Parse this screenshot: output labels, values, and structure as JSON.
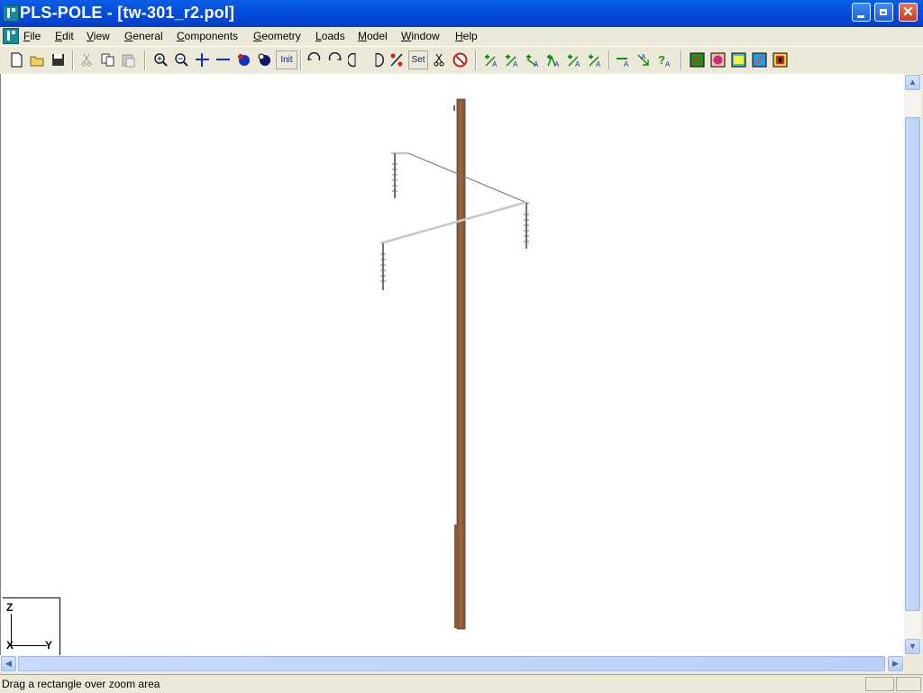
{
  "titlebar": {
    "title": "PLS-POLE - [tw-301_r2.pol]",
    "minimize_icon": "minimize-icon",
    "restore_icon": "restore-icon",
    "close_icon": "close-icon"
  },
  "menubar": {
    "items": [
      "File",
      "Edit",
      "View",
      "General",
      "Components",
      "Geometry",
      "Loads",
      "Model",
      "Window",
      "Help"
    ]
  },
  "toolbar": {
    "init_label": "Init",
    "set_label": "Set",
    "buttons": [
      "new-document-icon",
      "open-folder-icon",
      "save-disk-icon",
      "cut-icon",
      "copy-icon",
      "paste-icon",
      "zoom-in-icon",
      "zoom-out-icon",
      "expand-icon",
      "shrink-icon",
      "dot-icon",
      "dot-icon",
      "rotate-icon",
      "rotate-icon",
      "rotate-icon",
      "rotate-icon",
      "axes-icon",
      "scissors-icon",
      "no-entry-icon",
      "add-attachment-icon",
      "arrow-icon",
      "help-question-icon",
      "view-3d-icon",
      "render-icon",
      "render-icon",
      "render-icon",
      "render-icon"
    ]
  },
  "viewport": {
    "axis_labels": {
      "z": "Z",
      "x": "X",
      "y": "Y"
    },
    "colors": {
      "pole": "#8b5a3c",
      "arm": "#c8c8c8",
      "insulator": "#707070"
    }
  },
  "status": {
    "text": "Drag a rectangle over zoom area"
  }
}
